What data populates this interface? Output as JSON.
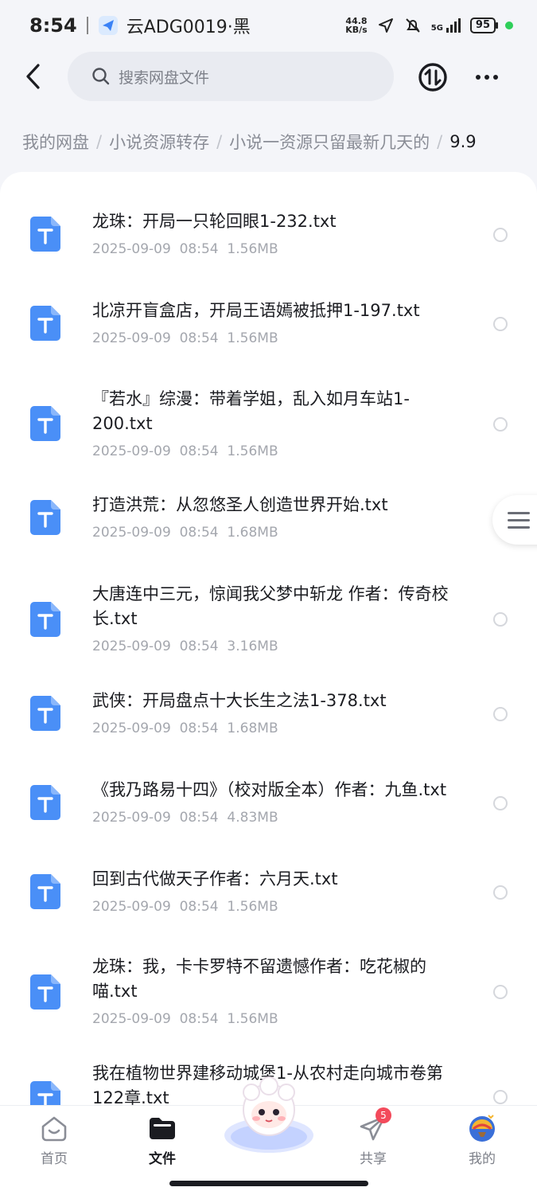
{
  "status_bar": {
    "time": "8:54",
    "carrier": "云ADG0019·黑",
    "net_speed_value": "44.8",
    "net_speed_unit": "KB/s",
    "network": "5G",
    "battery": "95"
  },
  "header": {
    "search_placeholder": "搜索网盘文件",
    "icons": [
      "back-icon",
      "search-icon",
      "transfer-icon",
      "more-icon"
    ]
  },
  "breadcrumb": {
    "items": [
      "我的网盘",
      "小说资源转存",
      "小说一资源只留最新几天的"
    ],
    "current": "9.9"
  },
  "files": [
    {
      "name": "龙珠：开局一只轮回眼1-232.txt",
      "date": "2025-09-09",
      "time": "08:54",
      "size": "1.56MB"
    },
    {
      "name": "北凉开盲盒店，开局王语嫣被抵押1-197.txt",
      "date": "2025-09-09",
      "time": "08:54",
      "size": "1.56MB"
    },
    {
      "name": "『若水』综漫：带着学姐，乱入如月车站1-200.txt",
      "date": "2025-09-09",
      "time": "08:54",
      "size": "1.56MB"
    },
    {
      "name": "打造洪荒：从忽悠圣人创造世界开始.txt",
      "date": "2025-09-09",
      "time": "08:54",
      "size": "1.68MB"
    },
    {
      "name": "大唐连中三元，惊闻我父梦中斩龙 作者：传奇校长.txt",
      "date": "2025-09-09",
      "time": "08:54",
      "size": "3.16MB"
    },
    {
      "name": "武侠：开局盘点十大长生之法1-378.txt",
      "date": "2025-09-09",
      "time": "08:54",
      "size": "1.68MB"
    },
    {
      "name": "《我乃路易十四》（校对版全本）作者：九鱼.txt",
      "date": "2025-09-09",
      "time": "08:54",
      "size": "4.83MB"
    },
    {
      "name": "回到古代做天子作者：六月天.txt",
      "date": "2025-09-09",
      "time": "08:54",
      "size": "1.56MB"
    },
    {
      "name": "龙珠：我，卡卡罗特不留遗憾作者：吃花椒的喵.txt",
      "date": "2025-09-09",
      "time": "08:54",
      "size": "1.56MB"
    },
    {
      "name": "我在植物世界建移动城堡1-从农村走向城市卷第122章.txt",
      "date": "",
      "time": "",
      "size": ""
    }
  ],
  "bottom_nav": {
    "tabs": [
      {
        "label": "首页",
        "icon": "home-icon"
      },
      {
        "label": "文件",
        "icon": "folder-icon"
      },
      {
        "label": "共享",
        "icon": "send-icon",
        "badge": "5"
      },
      {
        "label": "我的",
        "icon": "profile-avatar-icon"
      }
    ],
    "active": "文件"
  },
  "colors": {
    "file_icon": "#4a8ff7",
    "badge": "#f34a5b",
    "text_primary": "#1b1c21",
    "text_secondary": "#a4a7ae"
  }
}
